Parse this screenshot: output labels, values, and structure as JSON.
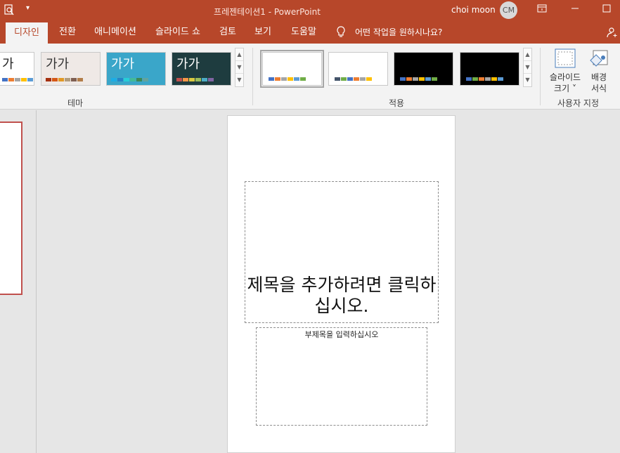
{
  "titlebar": {
    "title": "프레젠테이션1  -  PowerPoint",
    "user_name": "choi moon",
    "avatar_initials": "CM"
  },
  "tabs": [
    {
      "label": "디자인",
      "active": true
    },
    {
      "label": "전환"
    },
    {
      "label": "애니메이션"
    },
    {
      "label": "슬라이드 쇼"
    },
    {
      "label": "검토"
    },
    {
      "label": "보기"
    },
    {
      "label": "도움말"
    }
  ],
  "tell_me": "어떤 작업을 원하시나요?",
  "themes": {
    "group_label": "테마",
    "items": [
      {
        "label": "가",
        "bg": "#ffffff",
        "text_color": "#222222",
        "swatches": [
          "#4472c4",
          "#ed7d31",
          "#a5a5a5",
          "#ffc000",
          "#5b9bd5",
          "#70ad47"
        ]
      },
      {
        "label": "가가",
        "bg": "#efe9e6",
        "text_color": "#333333",
        "swatches": [
          "#a5300f",
          "#d55816",
          "#e19825",
          "#b19c7d",
          "#7f5f52",
          "#b27d49"
        ]
      },
      {
        "label": "가가",
        "bg": "#3aa6c9",
        "text_color": "#ffffff",
        "swatches": [
          "#1cade4",
          "#2683c6",
          "#27ced7",
          "#42ba97",
          "#3e8853",
          "#62a39f"
        ]
      },
      {
        "label": "가가",
        "bg": "#1e3c3f",
        "text_color": "#ffffff",
        "swatches": [
          "#c0504d",
          "#f79646",
          "#d9c93f",
          "#9bbb59",
          "#4bacc6",
          "#8064a2"
        ]
      }
    ]
  },
  "variants": {
    "group_label": "적용",
    "items": [
      {
        "bg": "#ffffff",
        "selected": true,
        "swatches": [
          "#4472c4",
          "#ed7d31",
          "#a5a5a5",
          "#ffc000",
          "#5b9bd5",
          "#70ad47"
        ]
      },
      {
        "bg": "#ffffff",
        "selected": false,
        "swatches": [
          "#44546a",
          "#70ad47",
          "#4472c4",
          "#ed7d31",
          "#a5a5a5",
          "#ffc000"
        ]
      },
      {
        "bg": "#000000",
        "selected": false,
        "swatches": [
          "#4472c4",
          "#ed7d31",
          "#a5a5a5",
          "#ffc000",
          "#5b9bd5",
          "#70ad47"
        ]
      },
      {
        "bg": "#000000",
        "selected": false,
        "swatches": [
          "#4472c4",
          "#70ad47",
          "#ed7d31",
          "#a5a5a5",
          "#ffc000",
          "#5b9bd5"
        ]
      }
    ]
  },
  "customize": {
    "group_label": "사용자 지정",
    "slide_size_line1": "슬라이드",
    "slide_size_line2": "크기 ˅",
    "background_line1": "배경",
    "background_line2": "서식"
  },
  "slide": {
    "title_placeholder": "제목을 추가하려면 클릭하십시오.",
    "subtitle_placeholder": "부제목을 입력하십시오"
  },
  "colors": {
    "accent": "#b7472a",
    "thumbnail_border": "#c0504d"
  }
}
